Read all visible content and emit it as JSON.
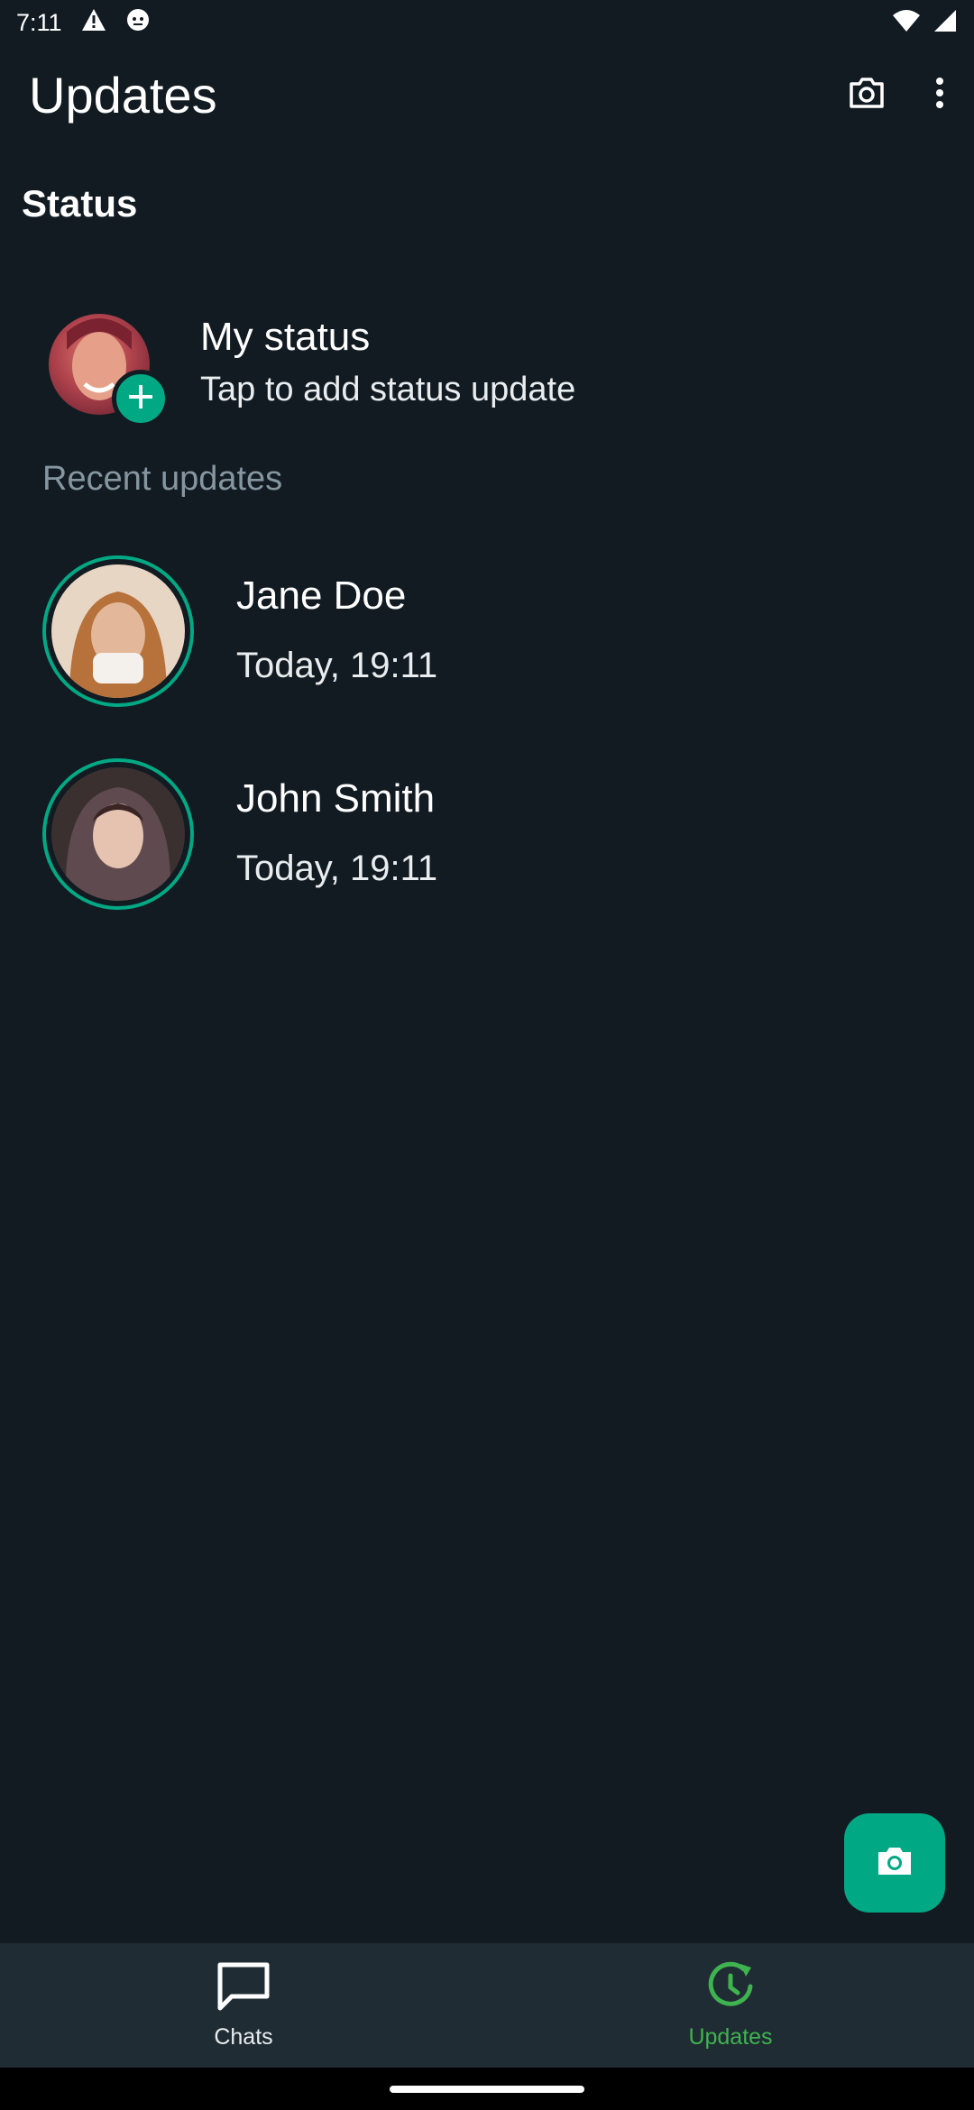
{
  "statusbar": {
    "time": "7:11"
  },
  "header": {
    "title": "Updates"
  },
  "status_section": {
    "title": "Status",
    "my_status": {
      "name": "My status",
      "subtitle": "Tap to add status update"
    },
    "recent_label": "Recent updates",
    "items": [
      {
        "name": "Jane Doe",
        "time": "Today, 19:11"
      },
      {
        "name": "John Smith",
        "time": "Today, 19:11"
      }
    ]
  },
  "bottom_nav": {
    "items": [
      {
        "label": "Chats",
        "active": false
      },
      {
        "label": "Updates",
        "active": true
      }
    ]
  },
  "colors": {
    "background": "#121B22",
    "accent": "#00A884",
    "nav_active": "#3FB34F",
    "nav_bg": "#1F2C34",
    "muted": "#8696A0"
  }
}
